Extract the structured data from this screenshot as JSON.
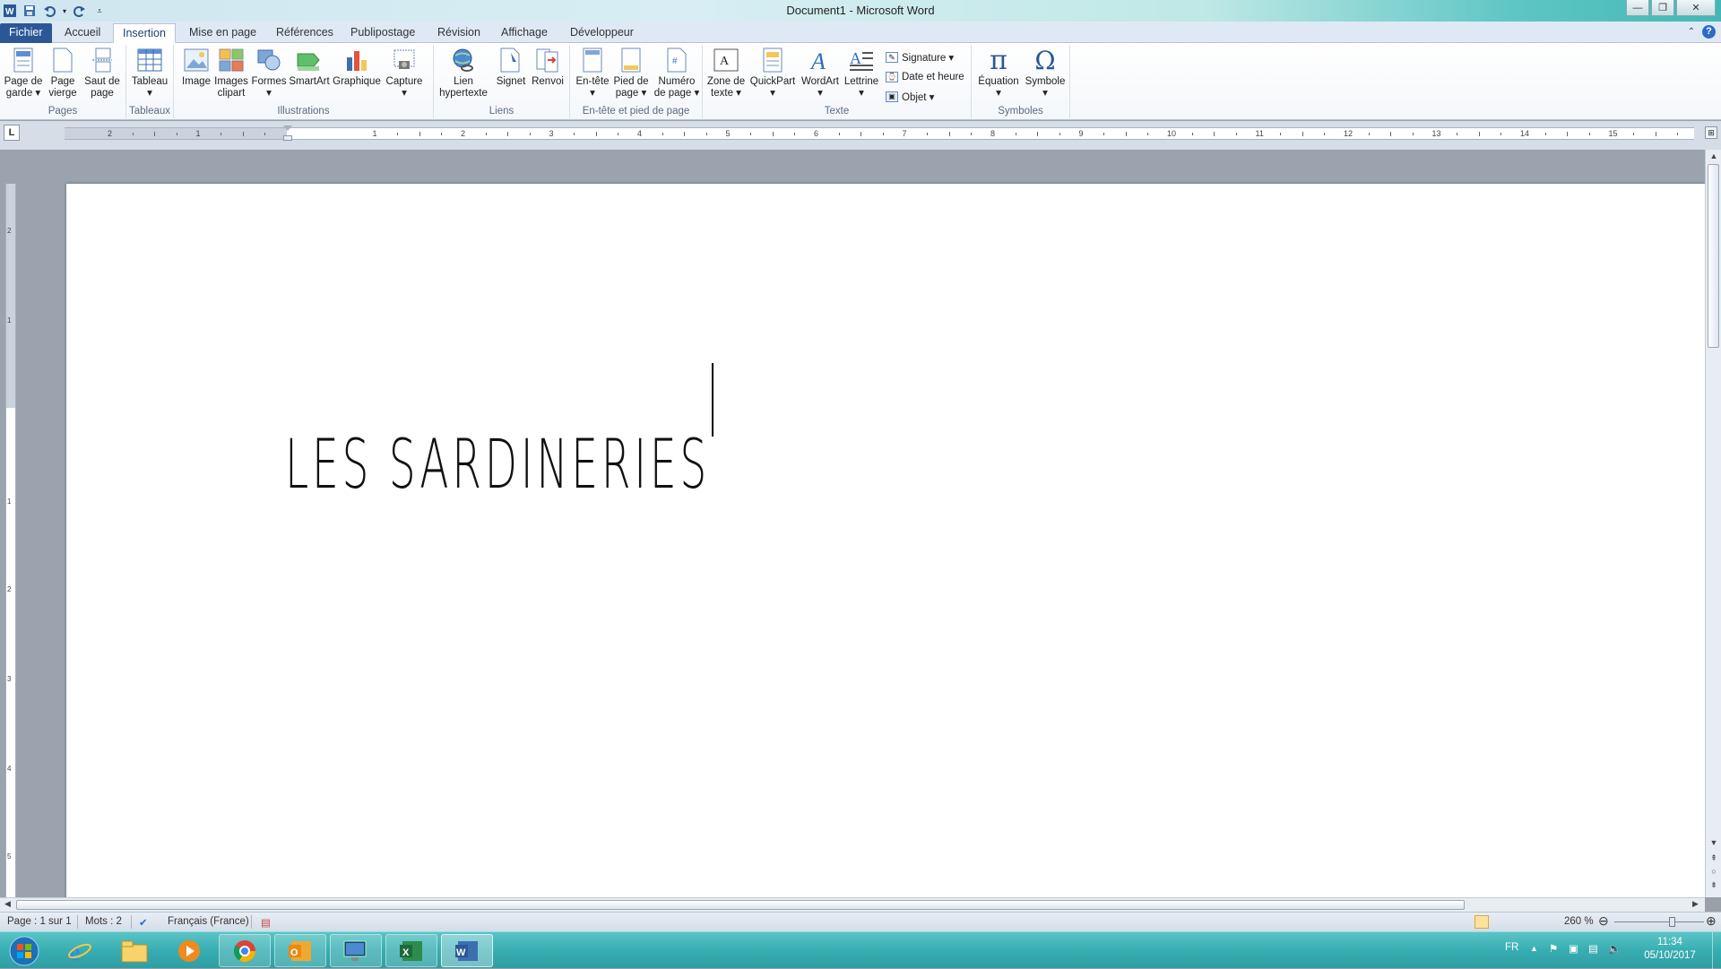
{
  "window": {
    "title": "Document1  -  Microsoft Word",
    "controls": [
      "minimize",
      "restore",
      "close"
    ]
  },
  "quick_access": [
    "word-icon",
    "save-icon",
    "undo-icon",
    "undo-dropdown-icon",
    "redo-icon",
    "customize-icon"
  ],
  "tabs": [
    {
      "label": "Fichier"
    },
    {
      "label": "Accueil"
    },
    {
      "label": "Insertion"
    },
    {
      "label": "Mise en page"
    },
    {
      "label": "Références"
    },
    {
      "label": "Publipostage"
    },
    {
      "label": "Révision"
    },
    {
      "label": "Affichage"
    },
    {
      "label": "Développeur"
    }
  ],
  "ribbon": {
    "groups": {
      "pages": {
        "label": "Pages",
        "buttons": [
          {
            "line1": "Page de",
            "line2": "garde ▾"
          },
          {
            "line1": "Page",
            "line2": "vierge"
          },
          {
            "line1": "Saut de",
            "line2": "page"
          }
        ]
      },
      "tableaux": {
        "label": "Tableaux",
        "buttons": [
          {
            "line1": "Tableau",
            "line2": "▾"
          }
        ]
      },
      "illustrations": {
        "label": "Illustrations",
        "buttons": [
          {
            "line1": "Image",
            "line2": ""
          },
          {
            "line1": "Images",
            "line2": "clipart"
          },
          {
            "line1": "Formes",
            "line2": "▾"
          },
          {
            "line1": "SmartArt",
            "line2": ""
          },
          {
            "line1": "Graphique",
            "line2": ""
          },
          {
            "line1": "Capture",
            "line2": "▾"
          }
        ]
      },
      "liens": {
        "label": "Liens",
        "buttons": [
          {
            "line1": "Lien",
            "line2": "hypertexte"
          },
          {
            "line1": "Signet",
            "line2": ""
          },
          {
            "line1": "Renvoi",
            "line2": ""
          }
        ]
      },
      "entete": {
        "label": "En-tête et pied de page",
        "buttons": [
          {
            "line1": "En-tête",
            "line2": "▾"
          },
          {
            "line1": "Pied de",
            "line2": "page ▾"
          },
          {
            "line1": "Numéro",
            "line2": "de page ▾"
          }
        ]
      },
      "texte": {
        "label": "Texte",
        "buttons": [
          {
            "line1": "Zone de",
            "line2": "texte ▾"
          },
          {
            "line1": "QuickPart",
            "line2": "▾"
          },
          {
            "line1": "WordArt",
            "line2": "▾"
          },
          {
            "line1": "Lettrine",
            "line2": "▾"
          }
        ],
        "small": [
          "Signature ▾",
          "Date et heure",
          "Objet ▾"
        ]
      },
      "symboles": {
        "label": "Symboles",
        "buttons": [
          {
            "line1": "Équation",
            "line2": "▾"
          },
          {
            "line1": "Symbole",
            "line2": "▾"
          }
        ]
      }
    }
  },
  "ruler": {
    "tab_selector": "L",
    "numbers": [
      "2",
      "1",
      "1",
      "2",
      "3",
      "4",
      "5",
      "6",
      "7",
      "8",
      "9",
      "10",
      "11",
      "12",
      "13",
      "14",
      "15"
    ],
    "vertical_numbers": [
      "2",
      "1",
      "1",
      "2",
      "3",
      "4",
      "5"
    ]
  },
  "document": {
    "text": "LES SARDINERIES"
  },
  "status": {
    "page": "Page : 1 sur 1",
    "words": "Mots : 2",
    "language": "Français (France)",
    "zoom": "260 %",
    "zoom_level_percent": 260
  },
  "taskbar": {
    "apps": [
      "internet-explorer-icon",
      "file-explorer-icon",
      "media-player-icon",
      "chrome-icon",
      "outlook-icon",
      "remote-desktop-icon",
      "excel-icon",
      "word-icon"
    ],
    "language": "FR",
    "time": "11:34",
    "date": "05/10/2017"
  },
  "colors": {
    "file_tab": "#2b5797",
    "taskbar": "#38aeb2",
    "active_view": "#fbe39a"
  }
}
